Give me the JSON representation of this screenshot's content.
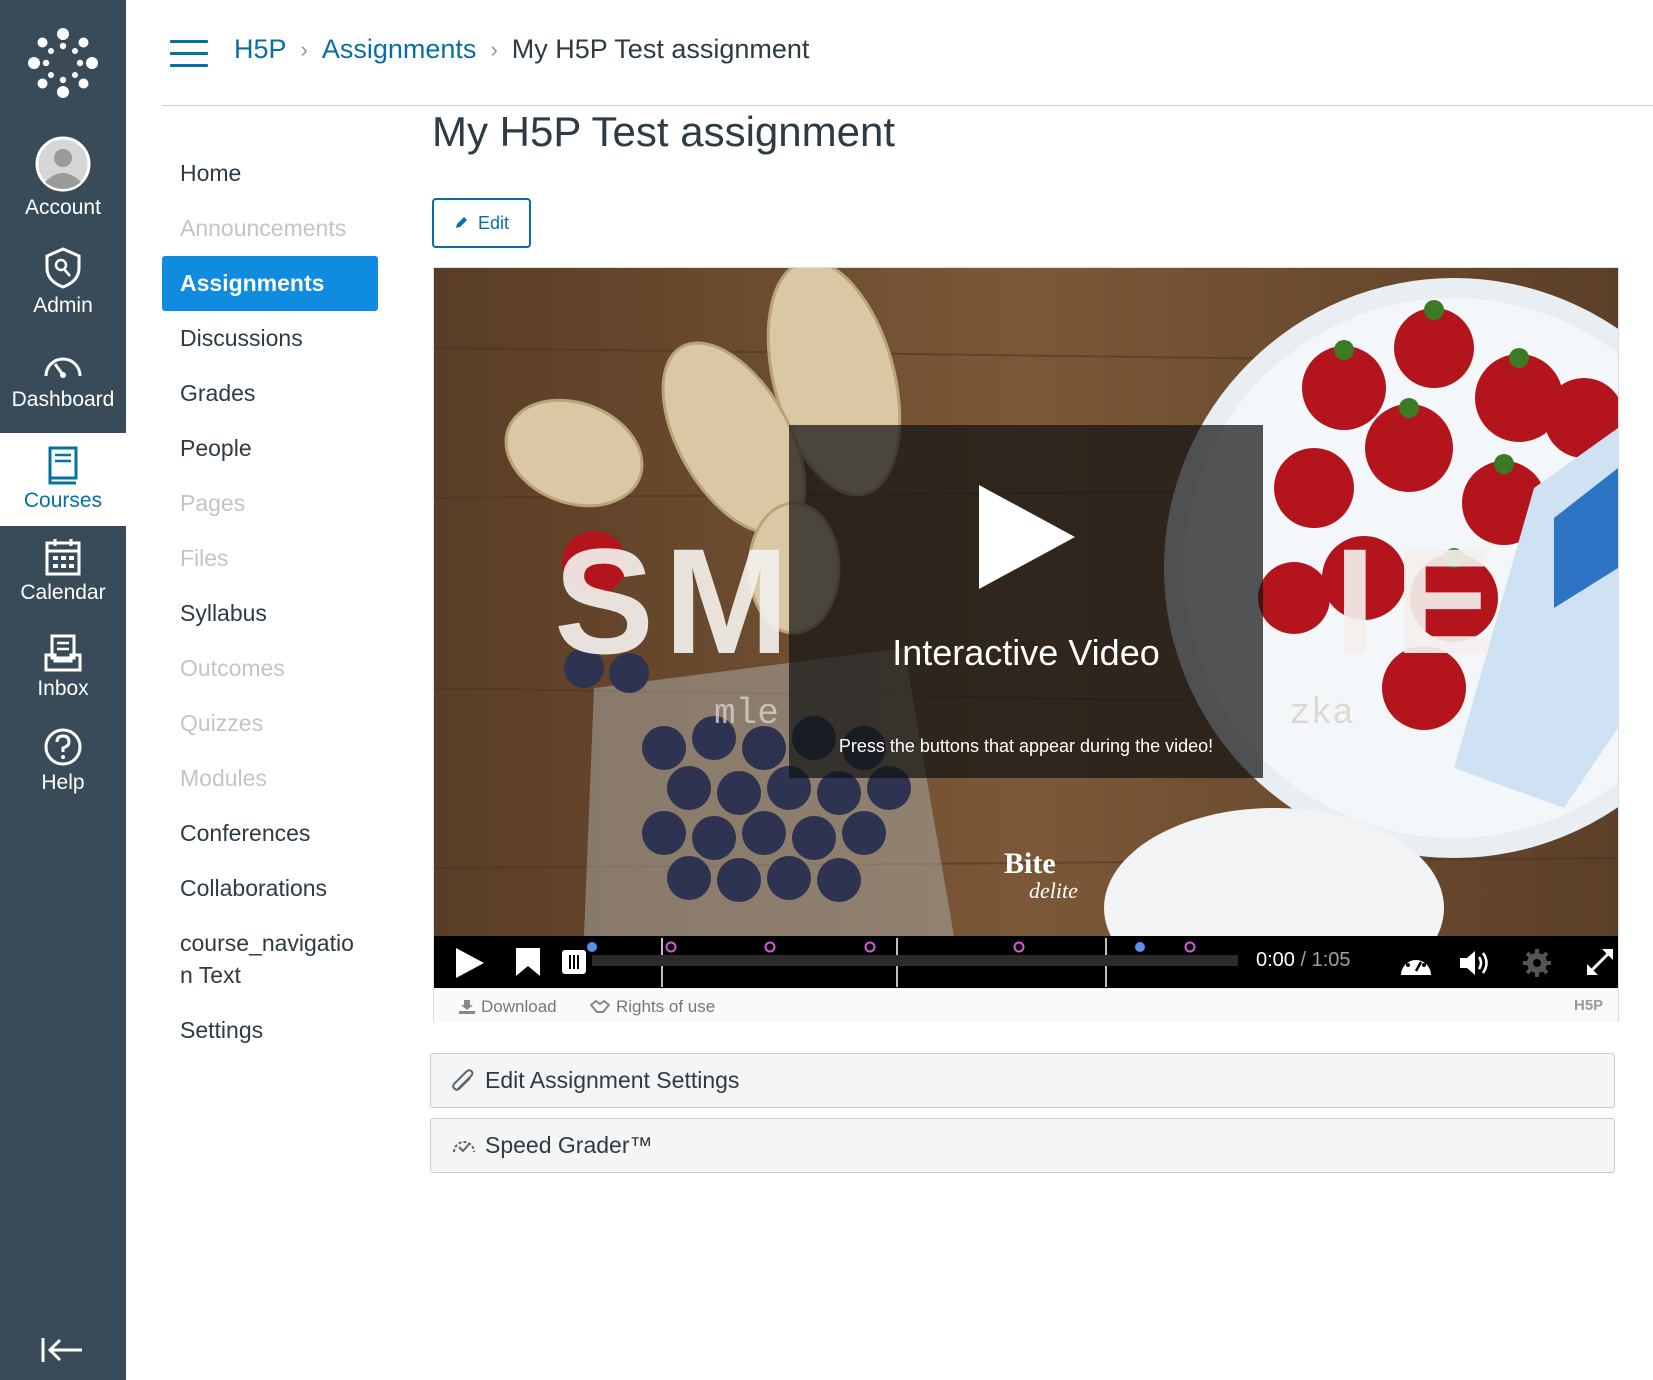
{
  "global_nav": {
    "items": [
      {
        "label": "Account",
        "icon": "account-avatar-icon"
      },
      {
        "label": "Admin",
        "icon": "admin-shield-icon"
      },
      {
        "label": "Dashboard",
        "icon": "dashboard-gauge-icon"
      },
      {
        "label": "Courses",
        "icon": "courses-book-icon",
        "active": true
      },
      {
        "label": "Calendar",
        "icon": "calendar-icon"
      },
      {
        "label": "Inbox",
        "icon": "inbox-icon"
      },
      {
        "label": "Help",
        "icon": "help-question-icon"
      }
    ],
    "colors": {
      "background": "#394b58",
      "active_text": "#0770a3"
    }
  },
  "breadcrumb": {
    "items": [
      "H5P",
      "Assignments",
      "My H5P Test assignment"
    ]
  },
  "course_nav": {
    "items": [
      {
        "label": "Home",
        "state": "normal"
      },
      {
        "label": "Announcements",
        "state": "disabled"
      },
      {
        "label": "Assignments",
        "state": "active"
      },
      {
        "label": "Discussions",
        "state": "normal"
      },
      {
        "label": "Grades",
        "state": "normal"
      },
      {
        "label": "People",
        "state": "normal"
      },
      {
        "label": "Pages",
        "state": "disabled"
      },
      {
        "label": "Files",
        "state": "disabled"
      },
      {
        "label": "Syllabus",
        "state": "normal"
      },
      {
        "label": "Outcomes",
        "state": "disabled"
      },
      {
        "label": "Quizzes",
        "state": "disabled"
      },
      {
        "label": "Modules",
        "state": "disabled"
      },
      {
        "label": "Conferences",
        "state": "normal"
      },
      {
        "label": "Collaborations",
        "state": "normal"
      },
      {
        "label": "course_navigatio n Text",
        "state": "normal"
      },
      {
        "label": "Settings",
        "state": "normal"
      }
    ],
    "colors": {
      "active_bg": "#0f8be0"
    }
  },
  "main": {
    "title": "My H5P Test assignment",
    "edit_label": "Edit"
  },
  "h5p": {
    "overlay_title": "Interactive Video",
    "overlay_subtitle": "Press the buttons that appear during the video!",
    "time_current": "0:00",
    "time_separator": "/",
    "time_duration": "1:05",
    "download_label": "Download",
    "rights_label": "Rights of use",
    "brand": "H5P"
  },
  "actions": {
    "edit_settings": "Edit Assignment Settings",
    "speed_grader": "Speed Grader™"
  }
}
